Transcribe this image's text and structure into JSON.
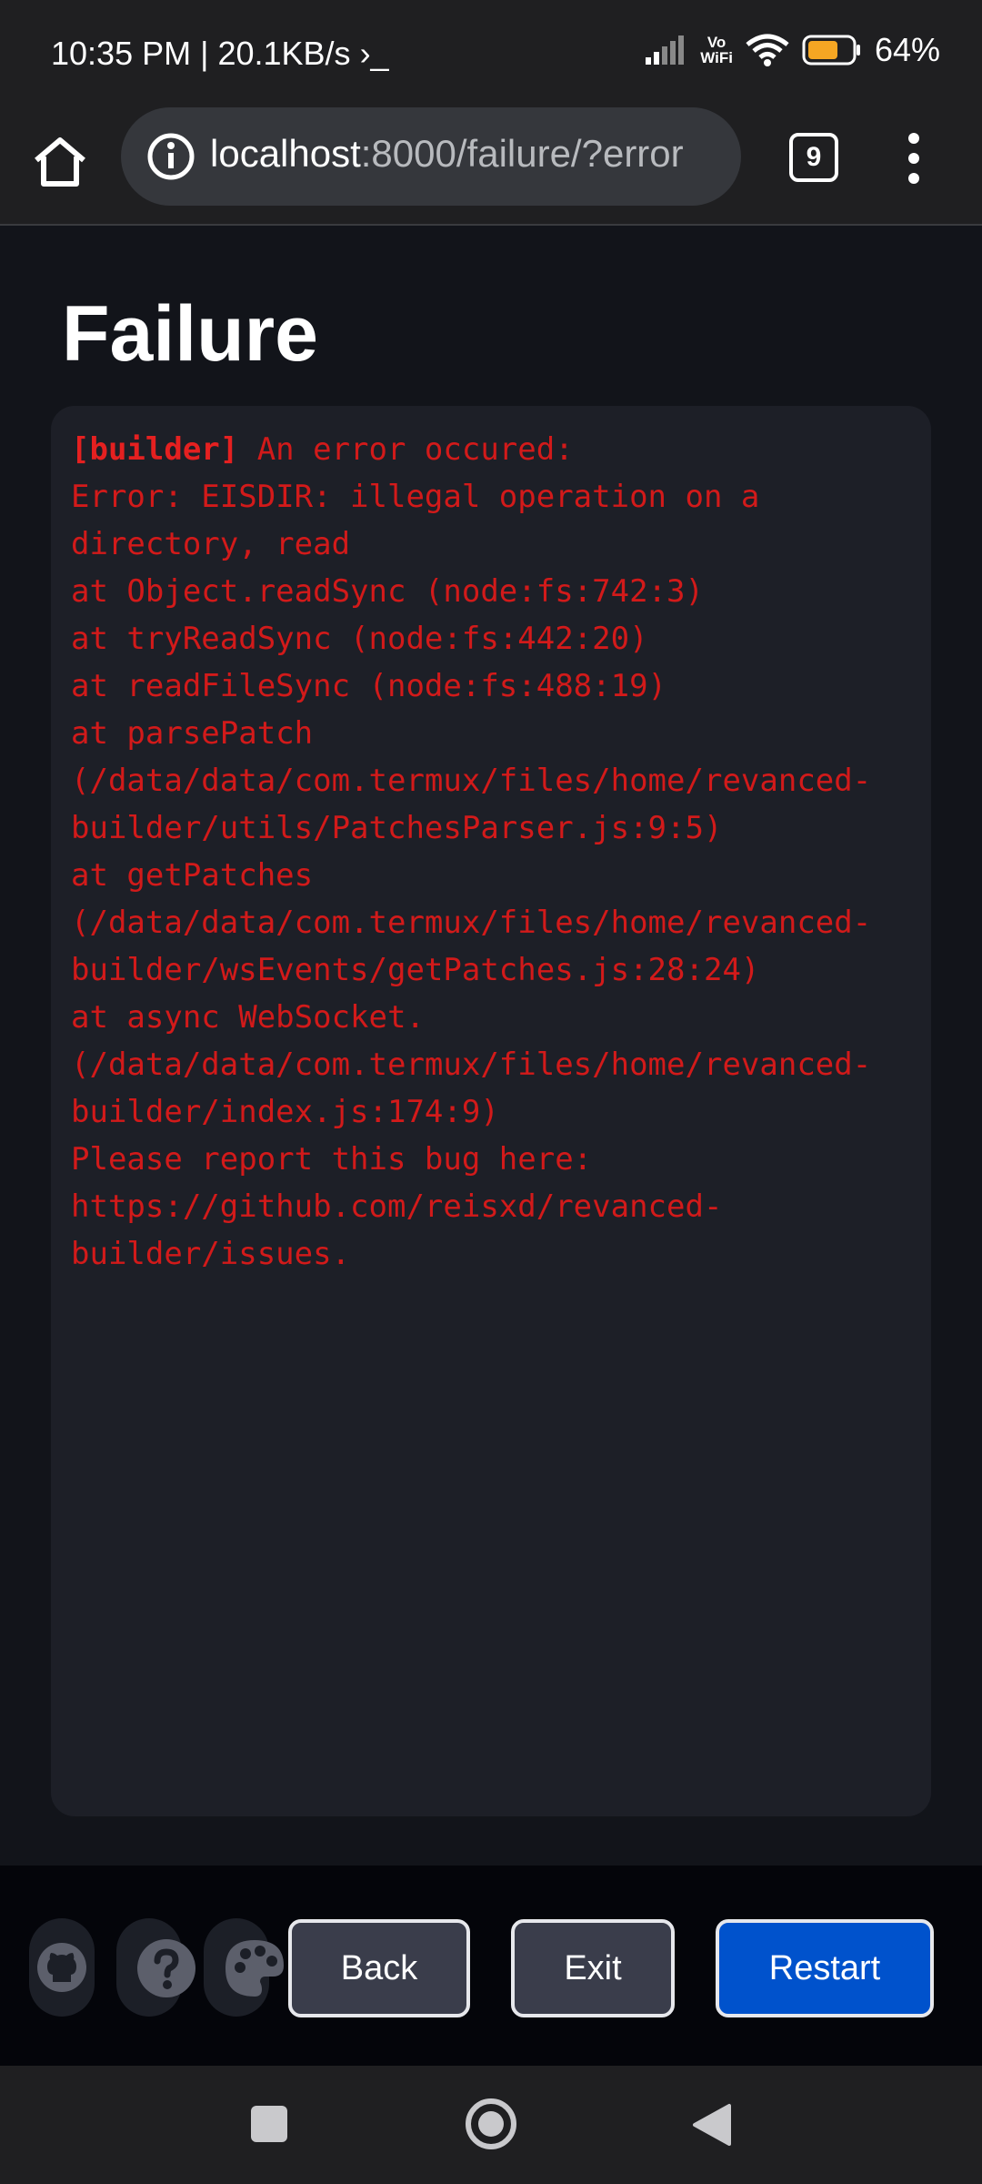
{
  "status_bar": {
    "time_info": "10:35 PM | 20.1KB/s",
    "vo_wifi_top": "Vo",
    "vo_wifi_bottom": "WiFi",
    "battery_percent": "64%"
  },
  "browser": {
    "url_host": "localhost",
    "url_path": ":8000/failure/?error",
    "tab_count": "9"
  },
  "page": {
    "title": "Failure",
    "error_tag": "[builder]",
    "error_lines": [
      " An error occured:",
      "Error: EISDIR: illegal operation on a",
      "directory, read",
      "at Object.readSync (node:fs:742:3)",
      "at tryReadSync (node:fs:442:20)",
      "at readFileSync (node:fs:488:19)",
      "at parsePatch",
      "(/data/data/com.termux/files/home/revanced-",
      "builder/utils/PatchesParser.js:9:5)",
      "at getPatches",
      "(/data/data/com.termux/files/home/revanced-",
      "builder/wsEvents/getPatches.js:28:24)",
      "at async WebSocket.",
      "(/data/data/com.termux/files/home/revanced-",
      "builder/index.js:174:9)",
      "Please report this bug here:",
      "https://github.com/reisxd/revanced-",
      "builder/issues."
    ]
  },
  "actions": {
    "back_label": "Back",
    "exit_label": "Exit",
    "restart_label": "Restart"
  },
  "icons": {
    "github": "github-icon",
    "help": "question-circle-icon",
    "theme": "palette-icon"
  },
  "colors": {
    "error_text": "#d21a1a",
    "restart_button": "#0052cc",
    "battery": "#f5a623"
  }
}
